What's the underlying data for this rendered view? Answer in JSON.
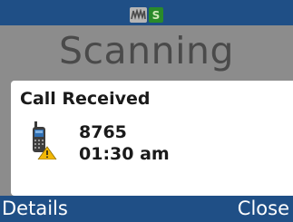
{
  "status_bar": {
    "mode_icon": "talkaround-mode-icon",
    "scan_icon_label": "S"
  },
  "screen": {
    "title": "Scanning"
  },
  "dialog": {
    "title": "Call Received",
    "caller_id": "8765",
    "time": "01:30 am",
    "icon": "radio-warning-icon"
  },
  "softkeys": {
    "left": "Details",
    "right": "Close"
  },
  "colors": {
    "bar": "#1f4f86",
    "backdrop": "#8c8c8c",
    "dialog": "#ffffff",
    "warning": "#f2b705"
  }
}
